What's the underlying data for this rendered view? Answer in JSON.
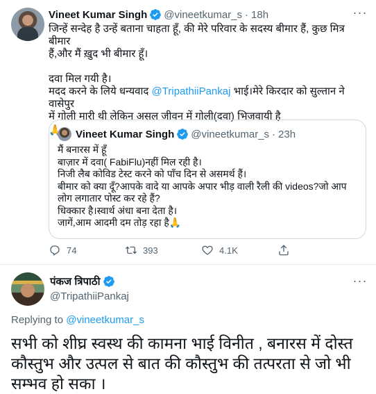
{
  "tweet": {
    "author_name": "Vineet Kumar Singh",
    "author_handle": "@vineetkumar_s",
    "separator": "·",
    "time": "18h",
    "lines": [
      "जिन्हें सन्देह है उन्हें बताना चाहता हूँ, की मेरे परिवार के सदस्य बीमार हैं, कुछ मित्र बीमार",
      "हैं,और मैं ख़ुद भी बीमार हूँ।"
    ],
    "line3": "दवा मिल गयी है।",
    "line4_pre": "मदद करने के लिये धन्यवाद ",
    "mention": "@TripathiiPankaj",
    "line4_post": " भाई।मेरे किरदार को सुल्तान ने वासेपुर",
    "line5": "में गोली मारी थी लेकिन असल जीवन में गोली(दवा) भिजवायी है",
    "emoji": "🙏"
  },
  "quote": {
    "author_name": "Vineet Kumar Singh",
    "author_handle": "@vineetkumar_s",
    "separator": "·",
    "time": "23h",
    "lines": [
      "मैं बनारस में हूँ",
      "बाज़ार में दवा( FabiFlu)नहीं मिल रही है।",
      "निजी लैब कोविड टेस्ट करने को पाँच दिन से असमर्थ हैं।",
      "बीमार को क्या दूँ?आपके वादे या आपके अपार भीड़ वाली रैली की videos?जो आप",
      "लोग लगातार पोस्ट कर रहे हैं?",
      "धिक्कार है।स्वार्थ अंधा बना देता है।",
      "जागें,आम आदमी दम तोड़ रहा है🙏"
    ]
  },
  "actions": {
    "replies": "74",
    "retweets": "393",
    "likes": "4.1K"
  },
  "reply": {
    "author_name": "पंकज त्रिपाठी",
    "author_handle": "@TripathiiPankaj",
    "replying_label": "Replying to ",
    "replying_to": "@vineetkumar_s",
    "text": "सभी को शीघ्र स्वस्थ की कामना भाई विनीत , बनारस में दोस्त कौस्तुभ और उत्पल से बात की कौस्तुभ की तत्परता से जो भी सम्भव हो सका ।"
  },
  "colors": {
    "accent": "#1d9bf0",
    "text": "#0f1419",
    "muted": "#536471",
    "border": "#cfd9de"
  }
}
